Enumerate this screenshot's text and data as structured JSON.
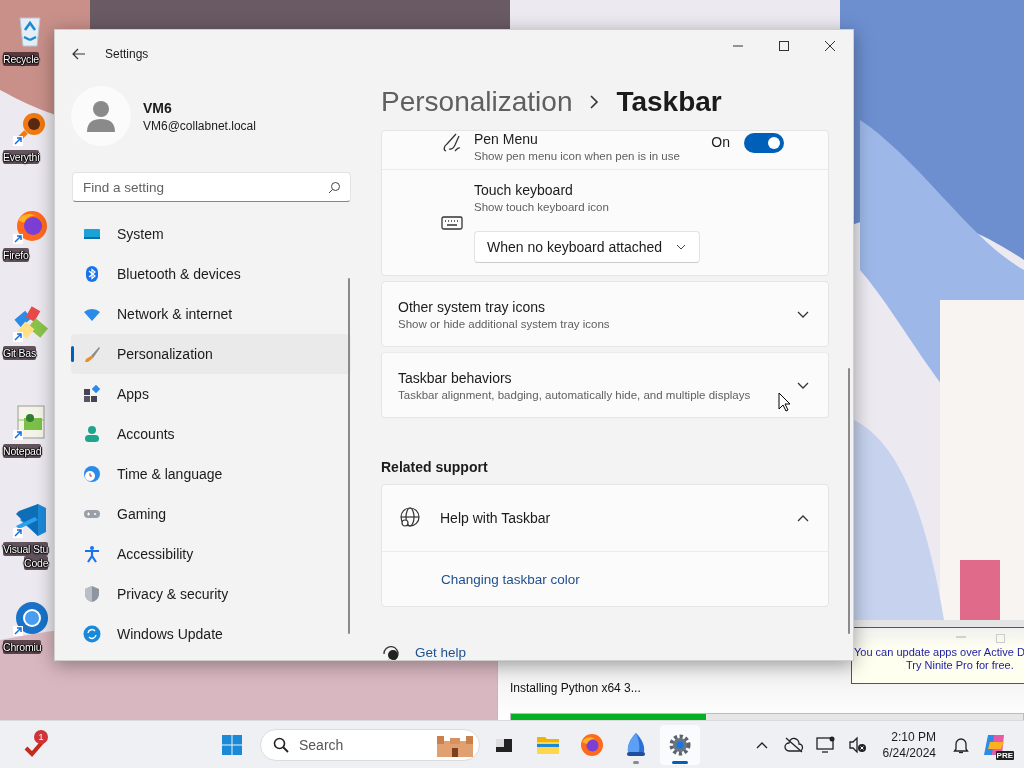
{
  "desktop_icons": [
    {
      "kind": "recycle",
      "lines": [
        "Recycle"
      ]
    },
    {
      "kind": "search-app",
      "lines": [
        "Everythi"
      ]
    },
    {
      "kind": "browser-fox",
      "lines": [
        "Firefo"
      ]
    },
    {
      "kind": "git",
      "lines": [
        "Git Bas"
      ]
    },
    {
      "kind": "notepad",
      "lines": [
        "Notepad"
      ]
    },
    {
      "kind": "code-editor",
      "lines": [
        "Visual Stu",
        "Code"
      ]
    },
    {
      "kind": "browser-round",
      "lines": [
        "Chromiu"
      ]
    }
  ],
  "installer": {
    "status": "Installing Python x64 3...",
    "level": 0.38,
    "notice": [
      "You can update apps over Active D",
      "Try Ninite Pro for free."
    ]
  },
  "settings": {
    "title": "Settings",
    "user": {
      "name": "VM6",
      "email": "VM6@collabnet.local"
    },
    "search": {
      "placeholder": "Find a setting"
    },
    "nav": [
      {
        "kind": "system",
        "label": "System",
        "selected": false
      },
      {
        "kind": "bluetooth",
        "label": "Bluetooth & devices",
        "selected": false
      },
      {
        "kind": "network",
        "label": "Network & internet",
        "selected": false
      },
      {
        "kind": "personalization",
        "label": "Personalization",
        "selected": true
      },
      {
        "kind": "apps",
        "label": "Apps",
        "selected": false
      },
      {
        "kind": "accounts",
        "label": "Accounts",
        "selected": false
      },
      {
        "kind": "time",
        "label": "Time & language",
        "selected": false
      },
      {
        "kind": "gaming",
        "label": "Gaming",
        "selected": false
      },
      {
        "kind": "accessibility",
        "label": "Accessibility",
        "selected": false
      },
      {
        "kind": "privacy",
        "label": "Privacy & security",
        "selected": false
      },
      {
        "kind": "update",
        "label": "Windows Update",
        "selected": false
      }
    ],
    "breadcrumb": {
      "parent": "Personalization",
      "current": "Taskbar"
    },
    "cards": [
      {
        "kind": "group",
        "rows": [
          {
            "kind": "toggle",
            "title": "Pen Menu",
            "subtitle": "Show pen menu icon when pen is in use",
            "state_label": "On",
            "on": true
          },
          {
            "kind": "dropdown",
            "title": "Touch keyboard",
            "subtitle": "Show touch keyboard icon",
            "value": "When no keyboard attached"
          }
        ]
      },
      {
        "kind": "expander",
        "title": "Other system tray icons",
        "subtitle": "Show or hide additional system tray icons",
        "expanded": false
      },
      {
        "kind": "expander",
        "title": "Taskbar behaviors",
        "subtitle": "Taskbar alignment, badging, automatically hide, and multiple displays",
        "expanded": false
      }
    ],
    "related_support": {
      "heading": "Related support",
      "items": [
        {
          "title": "Help with Taskbar",
          "expanded": true,
          "links": [
            "Changing taskbar color"
          ]
        }
      ]
    },
    "get_help": "Get help"
  },
  "taskbar": {
    "notification_badge": "1",
    "search_placeholder": "Search",
    "apps": [
      {
        "kind": "task-view",
        "running": false,
        "active": false
      },
      {
        "kind": "folder",
        "running": false,
        "active": false
      },
      {
        "kind": "browser-fox",
        "running": false,
        "active": false
      },
      {
        "kind": "sail",
        "running": true,
        "active": false
      },
      {
        "kind": "gear",
        "running": true,
        "active": true
      }
    ],
    "clock": {
      "time": "2:10 PM",
      "date": "6/24/2024"
    },
    "copilot_badge": "PRE"
  }
}
